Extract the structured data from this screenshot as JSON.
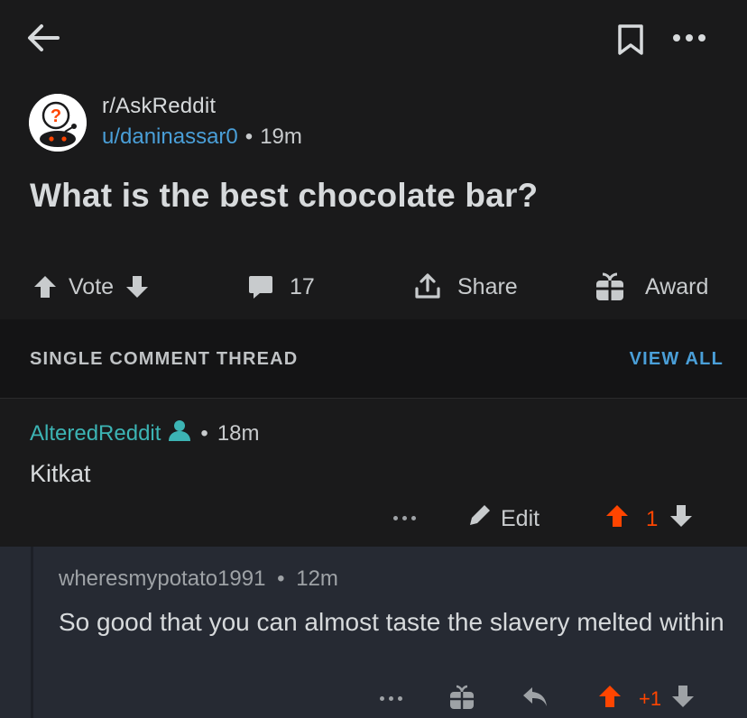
{
  "header": {
    "back_icon": "arrow-left-icon",
    "bookmark_icon": "bookmark-icon",
    "more_icon": "more-horizontal-icon"
  },
  "post": {
    "subreddit": "r/AskReddit",
    "author": "u/daninassar0",
    "separator": "•",
    "time": "19m",
    "title": "What is the best chocolate bar?",
    "actions": {
      "vote_label": "Vote",
      "comments_count": "17",
      "share_label": "Share",
      "award_label": "Award"
    }
  },
  "thread": {
    "label": "SINGLE COMMENT THREAD",
    "view_all": "VIEW ALL"
  },
  "comment": {
    "author": "AlteredReddit",
    "separator": "•",
    "time": "18m",
    "body": "Kitkat",
    "edit_label": "Edit",
    "score": "1"
  },
  "reply": {
    "author": "wheresmypotato1991",
    "separator": "•",
    "time": "12m",
    "body": "So good that you can almost taste the slavery melted within",
    "score": "+1"
  },
  "colors": {
    "background": "#1a1a1b",
    "link_blue": "#4a9fd8",
    "op_teal": "#3cb4b4",
    "upvote_orange": "#ff4500",
    "reply_background": "#262a33"
  }
}
